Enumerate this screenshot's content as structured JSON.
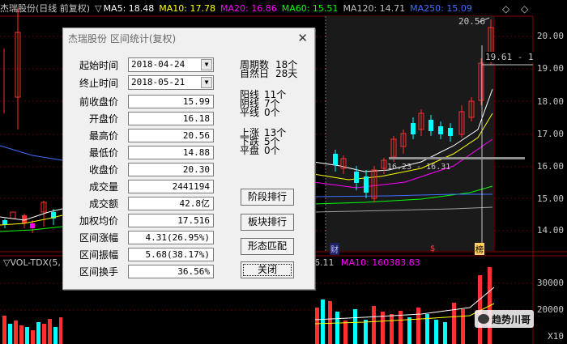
{
  "chart": {
    "title": "杰瑞股份(日线 前复权)",
    "ma": [
      {
        "label": "MA5: 18.48",
        "color": "#ffffff"
      },
      {
        "label": "MA10: 17.78",
        "color": "#ffff00"
      },
      {
        "label": "MA20: 16.86",
        "color": "#ff00ff"
      },
      {
        "label": "MA60: 15.51",
        "color": "#00ff00"
      },
      {
        "label": "MA120: 14.71",
        "color": "#c0c0c0"
      },
      {
        "label": "MA250: 15.09",
        "color": "#3f6fff"
      }
    ],
    "y_labels": [
      "20.00",
      "19.00",
      "18.00",
      "17.00",
      "16.00",
      "15.00",
      "14.00"
    ],
    "high_label": "20.56",
    "cursor_label": "19.61 - 1",
    "range_label": "16.23 - 16.31",
    "markers": [
      "财",
      "$",
      "榜"
    ],
    "vol_header": "▽VOL-TDX(5,",
    "vol_header_tail": "6.11",
    "vol_ma10": "MA10: 160383.83",
    "vol_y_labels": [
      "30000",
      "20000",
      "10000"
    ],
    "vol_unit": "X10",
    "watermark": "趋势川哥",
    "arrow_left": "◇",
    "arrow_right": "◇"
  },
  "dialog": {
    "title": "杰瑞股份 区间统计(复权)",
    "close": "✕",
    "start_label": "起始时间",
    "start_value": "2018-04-24",
    "end_label": "终止时间",
    "end_value": "2018-05-21",
    "rows": [
      {
        "label": "前收盘价",
        "value": "15.99"
      },
      {
        "label": "开盘价",
        "value": "16.18"
      },
      {
        "label": "最高价",
        "value": "20.56"
      },
      {
        "label": "最低价",
        "value": "14.88"
      },
      {
        "label": "收盘价",
        "value": "20.30"
      },
      {
        "label": "成交量",
        "value": "2441194"
      },
      {
        "label": "成交额",
        "value": "42.8亿"
      },
      {
        "label": "加权均价",
        "value": "17.516"
      },
      {
        "label": "区间涨幅",
        "value": "4.31(26.95%)"
      },
      {
        "label": "区间振幅",
        "value": "5.68(38.17%)"
      },
      {
        "label": "区间换手",
        "value": "36.56%"
      }
    ],
    "stats": {
      "cycles_label": "周期数",
      "cycles_value": "18个",
      "days_label": "自然日",
      "days_value": "28天",
      "yang_label": "阳线",
      "yang_value": "11个",
      "yin_label": "阴线",
      "yin_value": "7个",
      "flat_label": "平线",
      "flat_value": "0个",
      "up_label": "上涨",
      "up_value": "13个",
      "down_label": "下跌",
      "down_value": "5个",
      "even_label": "平盘",
      "even_value": "0个"
    },
    "buttons": {
      "stage_rank": "阶段排行",
      "sector_rank": "板块排行",
      "pattern_match": "形态匹配",
      "close": "关闭"
    }
  }
}
